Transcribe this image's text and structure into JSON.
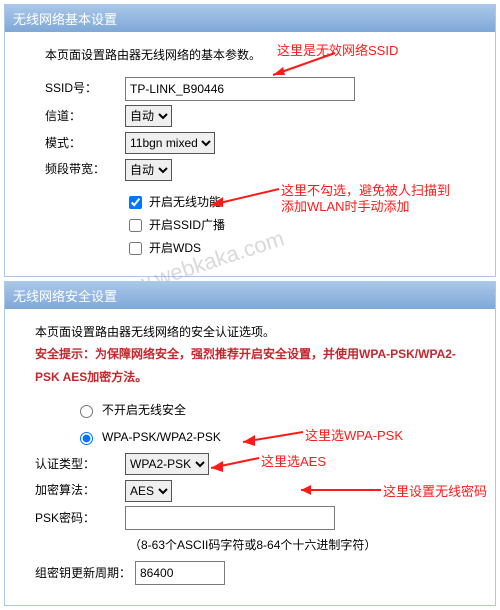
{
  "panel1": {
    "title": "无线网络基本设置",
    "intro": "本页面设置路由器无线网络的基本参数。",
    "ssid_label": "SSID号：",
    "ssid_value": "TP-LINK_B90446",
    "channel_label": "信道：",
    "channel_value": "自动",
    "mode_label": "模式：",
    "mode_value": "11bgn mixed",
    "bandwidth_label": "频段带宽：",
    "bandwidth_value": "自动",
    "cb_enable": "开启无线功能",
    "cb_broadcast": "开启SSID广播",
    "cb_wds": "开启WDS"
  },
  "panel2": {
    "title": "无线网络安全设置",
    "intro": "本页面设置路由器无线网络的安全认证选项。",
    "tip_prefix": "安全提示：",
    "tip_body": "为保障网络安全，强烈推荐开启安全设置，并使用WPA-PSK/WPA2-PSK AES加密方法。",
    "radio_none": "不开启无线安全",
    "radio_wpa": "WPA-PSK/WPA2-PSK",
    "auth_label": "认证类型：",
    "auth_value": "WPA2-PSK",
    "algo_label": "加密算法：",
    "algo_value": "AES",
    "psk_label": "PSK密码：",
    "psk_value": "",
    "psk_hint": "（8-63个ASCII码字符或8-64个十六进制字符）",
    "interval_label": "组密钥更新周期：",
    "interval_value": "86400"
  },
  "annot": {
    "a1": "这里是无效网络SSID",
    "a2a": "这里不勾选，避免被人扫描到",
    "a2b": "添加WLAN时手动添加",
    "a3": "这里选WPA-PSK",
    "a4": "这里选AES",
    "a5": "这里设置无线密码"
  },
  "watermark": "卡卡测 www.webkaka.com"
}
